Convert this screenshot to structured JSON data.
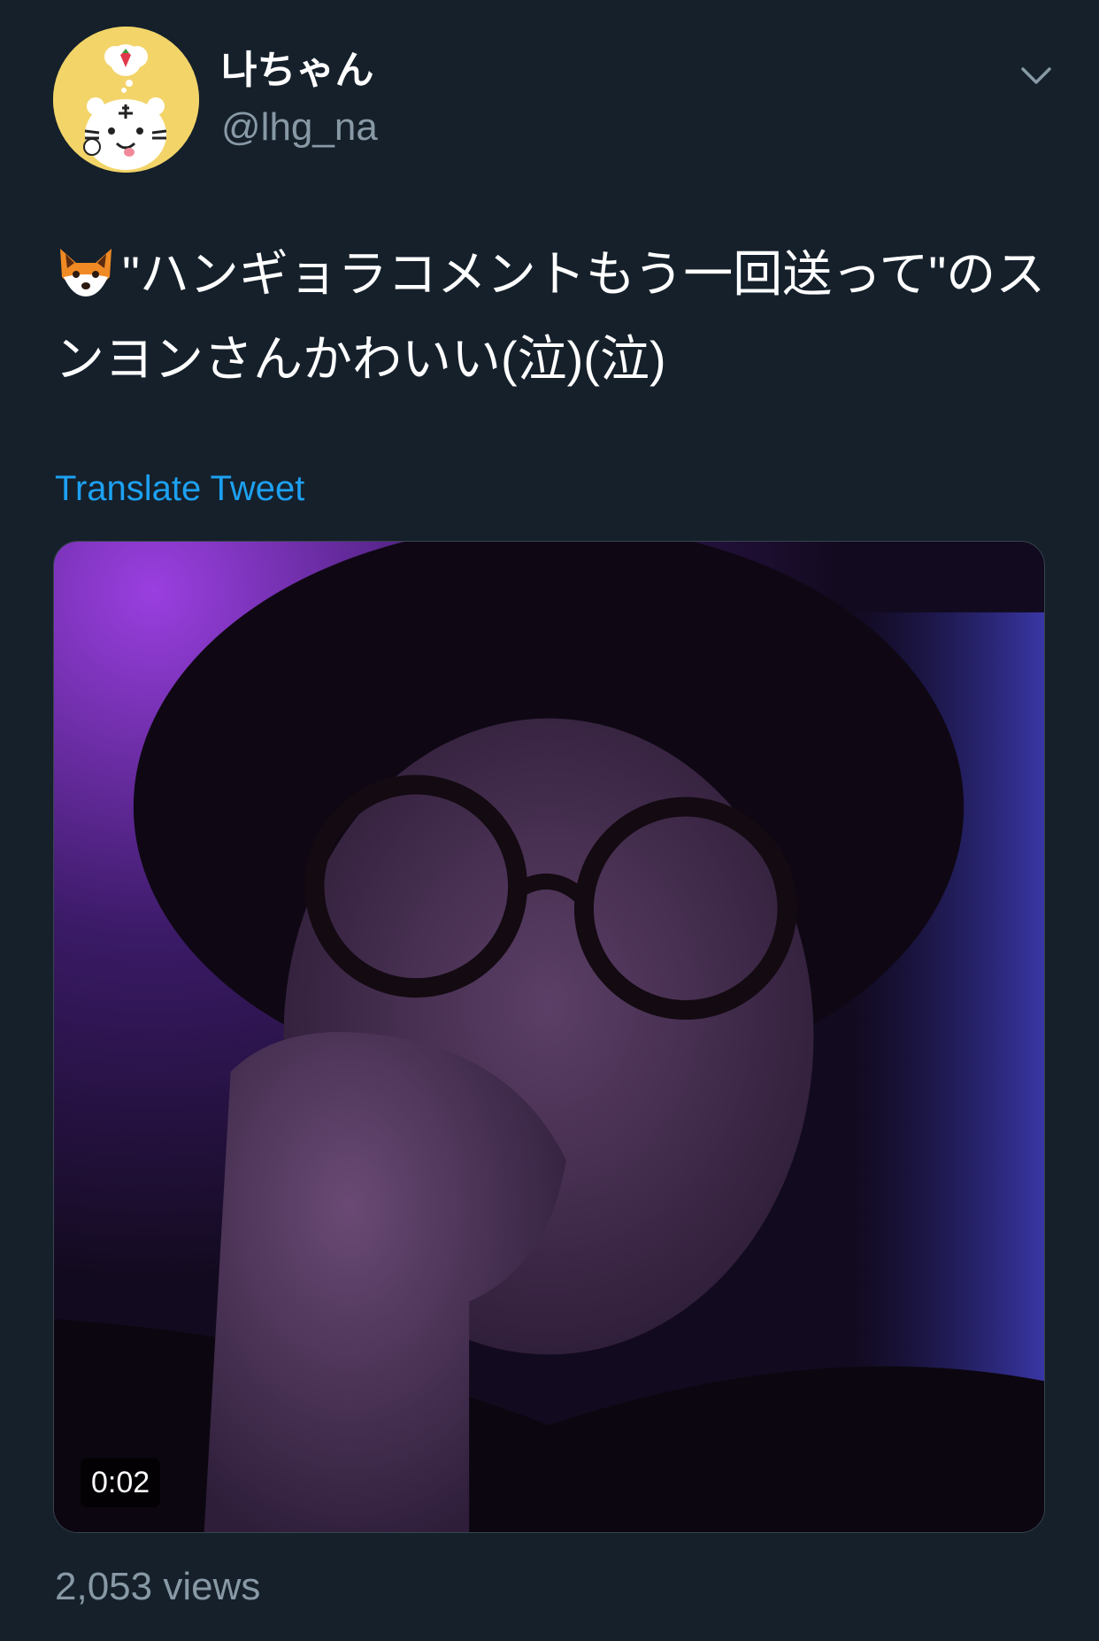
{
  "user": {
    "display_name": "나ちゃん",
    "handle": "@lhg_na",
    "avatar_icon": "tiger-avatar-icon"
  },
  "tweet": {
    "emoji_icon": "fox-face-icon",
    "text": "\"ハンギョラコメントもう一回送って\"のスンヨンさんかわいい(泣)(泣)",
    "translate_label": "Translate Tweet"
  },
  "media": {
    "type": "video",
    "duration": "0:02"
  },
  "stats": {
    "views": "2,053 views"
  },
  "colors": {
    "background": "#15202b",
    "link": "#1da1f2",
    "secondary_text": "#8899a6"
  }
}
